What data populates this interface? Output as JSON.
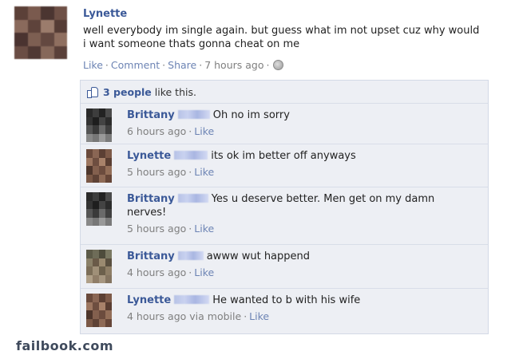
{
  "post": {
    "author": "Lynette",
    "text": "well everybody im single again. but guess what im not upset cuz why would i want someone thats gonna cheat on me",
    "actions": {
      "like": "Like",
      "comment": "Comment",
      "share": "Share",
      "time": "7 hours ago"
    },
    "separator": "·",
    "icon": "globe-icon"
  },
  "likes": {
    "count_text": "3 people",
    "suffix": "like this.",
    "icon": "thumb-up-icon"
  },
  "comments": [
    {
      "name": "Brittany",
      "text": "Oh no im sorry",
      "time": "6 hours ago",
      "via": "",
      "like": "Like"
    },
    {
      "name": "Lynette",
      "text": "its ok im better off anyways",
      "time": "5 hours ago",
      "via": "",
      "like": "Like"
    },
    {
      "name": "Brittany",
      "text": "Yes u deserve better. Men get on my damn nerves!",
      "time": "5 hours ago",
      "via": "",
      "like": "Like"
    },
    {
      "name": "Brittany",
      "text": "awww wut happend",
      "time": "4 hours ago",
      "via": "",
      "like": "Like"
    },
    {
      "name": "Lynette",
      "text": "He wanted to b with his wife",
      "time": "4 hours ago",
      "via": "via mobile",
      "like": "Like"
    }
  ],
  "watermark": "failbook.com",
  "colors": {
    "link": "#3b5998",
    "meta": "#7f7f7f",
    "feedback_bg": "#edeff4"
  }
}
